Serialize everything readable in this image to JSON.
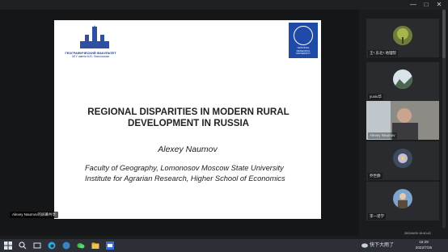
{
  "window": {
    "controls": [
      "—",
      "□",
      "✕"
    ]
  },
  "slide": {
    "msu_logo_text": "ГЕОГРАФИЧЕСКИЙ ФАКУЛЬТЕТ",
    "msu_logo_subtext": "МГУ имени М.В. Ломоносова",
    "hse_logo_text": "NATIONAL RESEARCH UNIVERSITY",
    "title_line1": "REGIONAL DISPARITIES IN MODERN RURAL",
    "title_line2": "DEVELOPMENT IN RUSSIA",
    "author": "Alexey Naumov",
    "affiliation1": "Faculty of Geography, Lomonosov Moscow State University",
    "affiliation2": "Institute for Agrarian Research, Higher School of Economics"
  },
  "speaker_tag": "Alexey Naumov的屏幕共享",
  "participants": [
    {
      "label": "王*,东北*.地理院",
      "avatar": "plant-avatar"
    },
    {
      "label": "yuxiu华",
      "avatar": "landscape-avatar"
    },
    {
      "label": "Alexey Naumov",
      "avatar": "video-feed"
    },
    {
      "label": "乔世静",
      "avatar": "flower-avatar"
    },
    {
      "label": "李一诺学",
      "avatar": "person-avatar"
    }
  ],
  "overlay_time": "2022/6/20 19:40:42",
  "taskbar": {
    "tray_text": "快下大雨了",
    "clock_time": "15:29",
    "clock_date": "2022/7/25"
  },
  "colors": {
    "accent_blue": "#1f4aa8",
    "taskbar": "#2c2f36",
    "background": "#1b1c1e"
  }
}
